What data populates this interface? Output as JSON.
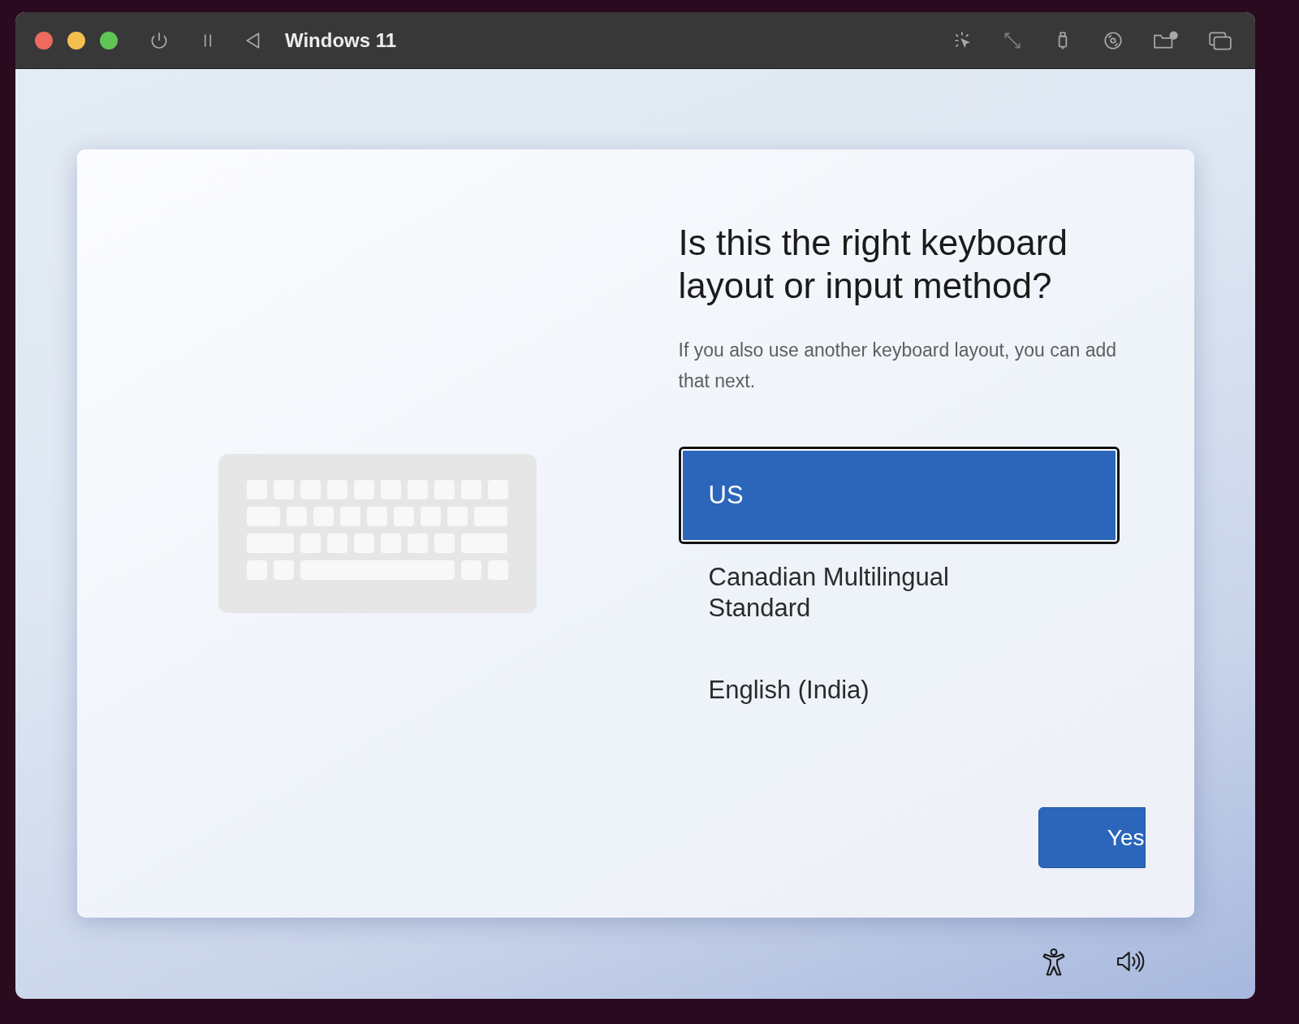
{
  "window": {
    "title": "Windows 11"
  },
  "page": {
    "heading": "Is this the right keyboard layout or input method?",
    "subtitle": "If you also use another keyboard layout, you can add that next."
  },
  "layouts": [
    {
      "label": "US",
      "selected": true
    },
    {
      "label": "Canadian Multilingual Standard",
      "selected": false
    },
    {
      "label": "English (India)",
      "selected": false
    }
  ],
  "primary_button": "Yes"
}
